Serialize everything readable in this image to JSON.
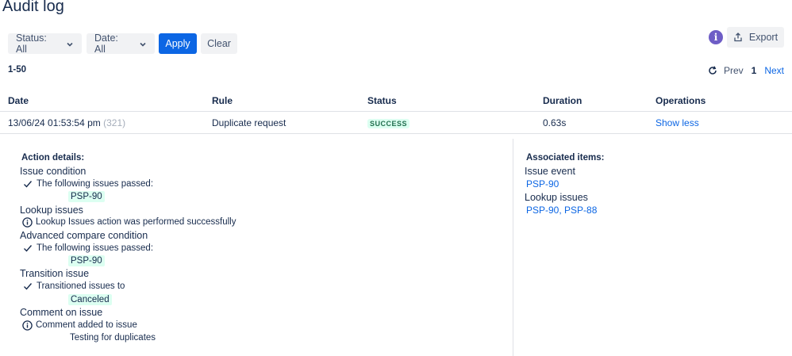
{
  "page": {
    "title": "Audit log"
  },
  "filters": {
    "status_label": "Status: All",
    "date_label": "Date: All",
    "apply_label": "Apply",
    "clear_label": "Clear"
  },
  "toolbar": {
    "info_glyph": "i",
    "export_label": "Export"
  },
  "pagination": {
    "range": "1-50",
    "prev": "Prev",
    "current": "1",
    "next": "Next"
  },
  "table": {
    "columns": [
      "Date",
      "Rule",
      "Status",
      "Duration",
      "Operations"
    ],
    "rows": [
      {
        "date": "13/06/24 01:53:54 pm",
        "count": "(321)",
        "rule": "Duplicate request",
        "status": "SUCCESS",
        "duration": "0.63s",
        "operation": "Show less"
      }
    ]
  },
  "details": {
    "action_header": "Action details:",
    "actions": [
      {
        "title": "Issue condition",
        "message": "The following issues passed:",
        "icon": "check-icon",
        "value": "PSP-90"
      },
      {
        "title": "Lookup issues",
        "message": "Lookup Issues action was performed successfully",
        "icon": "info-circle-icon"
      },
      {
        "title": "Advanced compare condition",
        "message": "The following issues passed:",
        "icon": "check-icon",
        "value": "PSP-90"
      },
      {
        "title": "Transition issue",
        "message": "Transitioned issues to",
        "icon": "check-icon",
        "value": "Canceled"
      },
      {
        "title": "Comment on issue",
        "message": "Comment added to issue",
        "icon": "info-circle-icon",
        "value": "Testing for duplicates"
      }
    ],
    "associated_header": "Associated items:",
    "associated": [
      {
        "title": "Issue event",
        "links": [
          "PSP-90"
        ]
      },
      {
        "title": "Lookup issues",
        "links_text": "PSP-90, PSP-88"
      }
    ]
  },
  "colors": {
    "primary": "#0c66e4",
    "success_text": "#216e4e",
    "success_bg": "#dcfff1",
    "info_badge": "#6e5dc6"
  }
}
